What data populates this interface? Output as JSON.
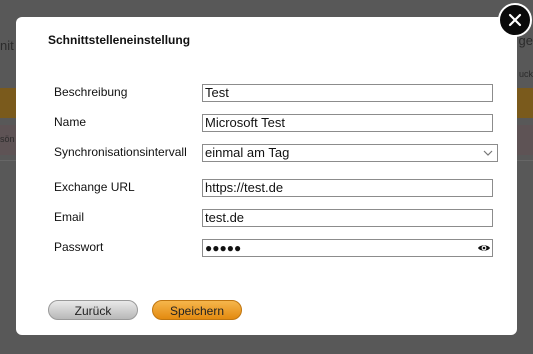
{
  "background": {
    "left_text_1": "nit",
    "left_text_2": "sön",
    "right_text_1": "ge",
    "right_text_2": "uck"
  },
  "dialog": {
    "title": "Schnittstelleneinstellung",
    "fields": [
      {
        "label": "Beschreibung",
        "value": "Test"
      },
      {
        "label": "Name",
        "value": "Microsoft Test"
      },
      {
        "label": "Synchronisationsintervall",
        "value": "einmal am Tag"
      },
      {
        "label": "Exchange URL",
        "value": "https://test.de"
      },
      {
        "label": "Email",
        "value": "test.de"
      },
      {
        "label": "Passwort",
        "value": "●●●●●"
      }
    ],
    "buttons": {
      "back_label": "Zurück",
      "save_label": "Speichern"
    }
  },
  "icons": {
    "close": "close-icon",
    "select": "chevron-down-icon",
    "password_toggle": "eye-icon"
  },
  "colors": {
    "save_button": "#e99a22",
    "back_button": "#cfcfcf",
    "close_button": "#0a0a0a"
  }
}
